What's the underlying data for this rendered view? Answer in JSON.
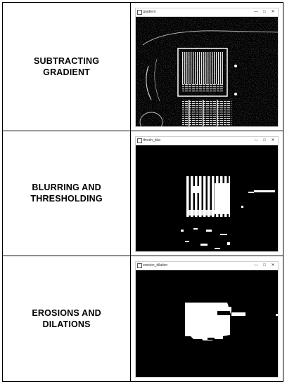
{
  "rows": [
    {
      "label": "SUBTRACTING\nGRADIENT",
      "window": {
        "title": "gradient",
        "min": "—",
        "max": "□",
        "close": "✕"
      }
    },
    {
      "label": "BLURRING AND\nTHRESHOLDING",
      "window": {
        "title": "thresh_blur",
        "min": "—",
        "max": "□",
        "close": "✕"
      }
    },
    {
      "label": "EROSIONS AND\nDILATIONS",
      "window": {
        "title": "erosion_dilation",
        "min": "—",
        "max": "□",
        "close": "✕"
      }
    }
  ],
  "colors": {
    "border": "#000000",
    "canvas": "#000000",
    "foreground": "#ffffff"
  }
}
